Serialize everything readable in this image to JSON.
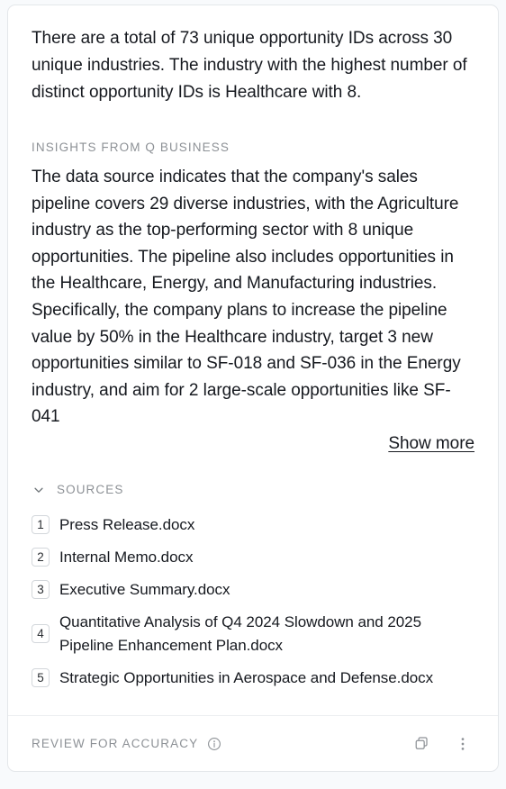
{
  "card": {
    "answer": "There are a total of 73 unique opportunity IDs across 30 unique industries. The industry with the highest number of distinct opportunity IDs is Healthcare with 8.",
    "insights": {
      "label": "Insights from Q Business",
      "text": "The data source indicates that the company's sales pipeline covers 29 diverse industries, with the Agriculture industry as the top-performing sector with 8 unique opportunities. The pipeline also includes opportunities in the Healthcare, Energy, and Manufacturing industries. Specifically, the company plans to increase the pipeline value by 50% in the Healthcare industry, target 3 new opportunities similar to SF-018 and SF-036 in the Energy industry, and aim for 2 large-scale opportunities like SF-041",
      "show_more_label": "Show more"
    },
    "sources": {
      "label": "Sources",
      "expand_icon": "chevron-down-icon",
      "items": [
        {
          "number": "1",
          "title": "Press Release.docx"
        },
        {
          "number": "2",
          "title": "Internal Memo.docx"
        },
        {
          "number": "3",
          "title": "Executive Summary.docx"
        },
        {
          "number": "4",
          "title": "Quantitative Analysis of Q4 2024 Slowdown and 2025 Pipeline Enhancement Plan.docx"
        },
        {
          "number": "5",
          "title": "Strategic Opportunities in Aerospace and Defense.docx"
        }
      ]
    },
    "footer": {
      "review_label": "Review for accuracy",
      "info_icon": "info-circle-icon",
      "copy_icon": "copy-icon",
      "more_icon": "more-vertical-icon"
    }
  },
  "colors": {
    "text_primary": "#16191f",
    "text_muted": "#8d9196",
    "card_border": "#e4e7ea",
    "page_background": "#f8fafc",
    "card_background": "#ffffff"
  }
}
